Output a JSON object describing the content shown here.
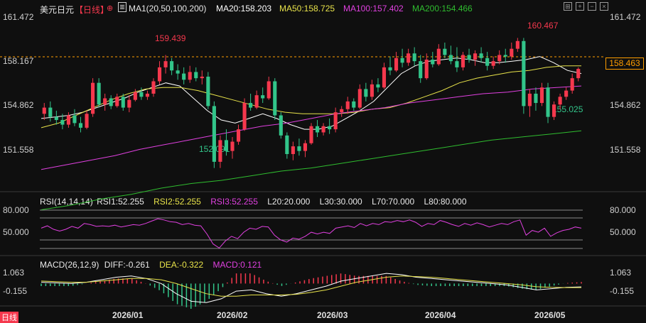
{
  "header": {
    "title": "美元日元",
    "period": "【日线】",
    "ma1": "MA1(20,50,100,200)",
    "ma20": "MA20:158.203",
    "ma50": "MA50:158.725",
    "ma100": "MA100:157.402",
    "ma200": "MA200:154.466"
  },
  "rsi_header": {
    "name": "RSI(14,14,14)",
    "rsi1": "RSI1:52.255",
    "rsi2": "RSI2:52.255",
    "rsi3": "RSI3:52.255",
    "l20": "L20:20.000",
    "l30": "L30:30.000",
    "l70": "L70:70.000",
    "l80": "L80:80.000"
  },
  "macd_header": {
    "name": "MACD(26,12,9)",
    "diff": "DIFF:-0.261",
    "dea": "DEA:-0.322",
    "macd": "MACD:0.121"
  },
  "price_axis": [
    "161.472",
    "158.167",
    "154.862",
    "151.558"
  ],
  "rsi_axis": [
    "80.000",
    "50.000"
  ],
  "macd_axis": [
    "1.063",
    "-0.155"
  ],
  "x_axis": [
    "2026/01",
    "2026/02",
    "2026/03",
    "2026/04",
    "2026/05"
  ],
  "annotations": {
    "high1": "159.439",
    "low1": "152.091",
    "high2": "160.467",
    "low2": "155.025",
    "last_price": "158.463"
  },
  "bottom_mark": "日线",
  "colors": {
    "up": "#f5384d",
    "down": "#32c58a",
    "ma20": "#ffffff",
    "ma50": "#e8e34a",
    "ma100": "#e040e0",
    "ma200": "#2fbd2f",
    "rsi": "#e040e0",
    "dea": "#e8e34a",
    "last_price": "#ff9d00"
  },
  "chart_data": [
    {
      "type": "candlestick",
      "title": "美元日元 日线",
      "ylim": [
        150.8,
        162.4
      ],
      "x_range": [
        "2025-12-01",
        "2026-05-10"
      ],
      "candles_ohlc_approx": [
        [
          155.6,
          156.3,
          155.2,
          156.0
        ],
        [
          156.0,
          156.4,
          155.1,
          155.4
        ],
        [
          155.4,
          155.8,
          154.9,
          155.2
        ],
        [
          155.2,
          155.6,
          154.6,
          154.9
        ],
        [
          154.9,
          155.7,
          154.7,
          155.5
        ],
        [
          155.5,
          155.9,
          154.8,
          155.0
        ],
        [
          155.0,
          155.4,
          154.4,
          154.7
        ],
        [
          154.7,
          155.8,
          154.6,
          155.6
        ],
        [
          155.6,
          157.9,
          155.4,
          157.6
        ],
        [
          157.6,
          157.9,
          156.0,
          156.2
        ],
        [
          156.2,
          156.9,
          155.8,
          156.6
        ],
        [
          156.6,
          156.8,
          155.9,
          156.1
        ],
        [
          156.1,
          156.9,
          156.0,
          156.7
        ],
        [
          156.7,
          156.9,
          155.8,
          156.0
        ],
        [
          156.0,
          156.8,
          155.7,
          156.5
        ],
        [
          156.5,
          157.2,
          156.4,
          157.0
        ],
        [
          157.0,
          157.3,
          156.5,
          156.7
        ],
        [
          156.7,
          157.1,
          156.5,
          156.9
        ],
        [
          156.9,
          157.9,
          156.7,
          157.7
        ],
        [
          157.7,
          159.0,
          157.5,
          158.6
        ],
        [
          158.6,
          159.4,
          158.2,
          159.0
        ],
        [
          159.0,
          159.2,
          158.1,
          158.4
        ],
        [
          158.4,
          158.8,
          157.8,
          158.2
        ],
        [
          158.2,
          158.6,
          157.5,
          157.8
        ],
        [
          157.8,
          158.7,
          157.6,
          158.3
        ],
        [
          158.3,
          158.6,
          157.7,
          157.9
        ],
        [
          157.9,
          158.4,
          157.5,
          158.0
        ],
        [
          158.0,
          158.3,
          155.9,
          156.1
        ],
        [
          156.1,
          156.4,
          152.1,
          152.5
        ],
        [
          152.5,
          154.2,
          152.1,
          153.9
        ],
        [
          153.9,
          154.6,
          152.9,
          153.2
        ],
        [
          153.2,
          154.1,
          152.7,
          153.8
        ],
        [
          153.8,
          154.9,
          153.6,
          154.6
        ],
        [
          154.6,
          156.6,
          154.5,
          156.3
        ],
        [
          156.3,
          156.9,
          155.8,
          156.0
        ],
        [
          156.0,
          157.1,
          155.9,
          156.8
        ],
        [
          156.8,
          157.3,
          156.3,
          156.6
        ],
        [
          156.6,
          158.0,
          156.5,
          157.7
        ],
        [
          157.7,
          157.9,
          155.2,
          155.5
        ],
        [
          155.5,
          155.7,
          154.0,
          154.2
        ],
        [
          154.2,
          154.4,
          152.7,
          153.0
        ],
        [
          153.0,
          153.8,
          152.6,
          153.5
        ],
        [
          153.5,
          154.0,
          152.9,
          153.2
        ],
        [
          153.2,
          153.9,
          152.8,
          153.7
        ],
        [
          153.7,
          155.0,
          153.6,
          154.8
        ],
        [
          154.8,
          155.2,
          154.1,
          154.4
        ],
        [
          154.4,
          155.0,
          154.2,
          154.8
        ],
        [
          154.8,
          155.3,
          154.3,
          154.6
        ],
        [
          154.6,
          156.0,
          154.4,
          155.7
        ],
        [
          155.7,
          156.1,
          155.4,
          155.9
        ],
        [
          155.9,
          156.7,
          155.6,
          156.4
        ],
        [
          156.4,
          156.6,
          155.8,
          156.0
        ],
        [
          156.0,
          157.5,
          155.9,
          157.2
        ],
        [
          157.2,
          157.6,
          156.4,
          156.7
        ],
        [
          156.7,
          157.8,
          156.5,
          157.5
        ],
        [
          157.5,
          157.9,
          157.0,
          157.3
        ],
        [
          157.3,
          158.9,
          157.2,
          158.6
        ],
        [
          158.6,
          159.3,
          158.1,
          158.4
        ],
        [
          158.4,
          159.6,
          158.3,
          159.2
        ],
        [
          159.2,
          159.8,
          158.6,
          158.9
        ],
        [
          158.9,
          159.8,
          158.7,
          159.5
        ],
        [
          159.5,
          159.9,
          158.7,
          159.0
        ],
        [
          159.0,
          159.4,
          157.6,
          157.9
        ],
        [
          157.9,
          159.5,
          157.8,
          159.1
        ],
        [
          159.1,
          159.6,
          158.6,
          158.8
        ],
        [
          158.8,
          160.1,
          158.7,
          159.8
        ],
        [
          159.8,
          160.2,
          159.2,
          159.4
        ],
        [
          159.4,
          160.0,
          158.8,
          159.0
        ],
        [
          159.0,
          159.9,
          158.3,
          158.6
        ],
        [
          158.6,
          159.6,
          158.4,
          159.4
        ],
        [
          159.4,
          159.8,
          158.9,
          159.1
        ],
        [
          159.1,
          159.7,
          158.7,
          159.5
        ],
        [
          159.5,
          159.9,
          158.9,
          159.2
        ],
        [
          159.2,
          159.6,
          158.4,
          158.7
        ],
        [
          158.7,
          159.3,
          158.5,
          159.0
        ],
        [
          159.0,
          159.7,
          158.8,
          159.4
        ],
        [
          159.4,
          159.8,
          158.9,
          159.3
        ],
        [
          159.3,
          160.2,
          159.1,
          159.8
        ],
        [
          159.8,
          160.5,
          159.6,
          160.3
        ],
        [
          160.3,
          160.5,
          155.6,
          156.1
        ],
        [
          156.1,
          157.2,
          155.4,
          156.9
        ],
        [
          156.9,
          157.3,
          155.8,
          156.3
        ],
        [
          156.3,
          157.6,
          156.1,
          157.3
        ],
        [
          157.3,
          157.6,
          155.0,
          155.4
        ],
        [
          155.4,
          156.4,
          155.2,
          156.2
        ],
        [
          156.2,
          156.9,
          155.9,
          156.7
        ],
        [
          156.7,
          157.3,
          156.5,
          157.1
        ],
        [
          157.1,
          158.2,
          156.9,
          157.9
        ],
        [
          157.9,
          158.6,
          157.7,
          158.5
        ]
      ],
      "series": [
        {
          "name": "MA20",
          "values": [
            155.3,
            155.4,
            155.5,
            155.7,
            156.0,
            156.3,
            156.6,
            157.0,
            157.3,
            157.6,
            157.4,
            156.6,
            155.8,
            155.2,
            155.0,
            155.3,
            155.6,
            155.3,
            154.9,
            154.6,
            154.6,
            154.8,
            155.3,
            155.8,
            156.4,
            157.3,
            158.2,
            158.7,
            159.0,
            159.1,
            159.2,
            159.1,
            158.9,
            158.9,
            159.0,
            159.1,
            159.3,
            158.9,
            158.4,
            158.2
          ]
        },
        {
          "name": "MA50",
          "values": [
            154.7,
            155.0,
            155.5,
            156.0,
            156.5,
            156.9,
            157.2,
            157.3,
            157.3,
            157.1,
            156.8,
            156.5,
            156.2,
            155.9,
            155.7,
            155.6,
            155.6,
            155.6,
            155.7,
            155.9,
            156.0,
            156.3,
            156.7,
            157.1,
            157.6,
            157.9,
            158.1,
            158.3,
            158.4,
            158.6,
            158.7,
            158.7
          ]
        },
        {
          "name": "MA100",
          "values": [
            152.0,
            152.3,
            152.6,
            152.9,
            153.3,
            153.6,
            153.9,
            154.2,
            154.5,
            154.8,
            155.0,
            155.3,
            155.6,
            155.8,
            156.0,
            156.3,
            156.5,
            156.7,
            156.9,
            157.0,
            157.2,
            157.3,
            157.4
          ]
        },
        {
          "name": "MA200",
          "values": [
            149.4,
            149.7,
            150.1,
            150.4,
            150.8,
            151.1,
            151.3,
            151.6,
            151.9,
            152.1,
            152.4,
            152.7,
            153.0,
            153.3,
            153.6,
            153.9,
            154.1,
            154.3,
            154.5
          ]
        }
      ]
    },
    {
      "type": "line",
      "title": "RSI(14,14,14)",
      "ylim": [
        10,
        90
      ],
      "values_approx": [
        52,
        56,
        50,
        47,
        50,
        55,
        52,
        60,
        58,
        55,
        56,
        55,
        57,
        54,
        56,
        58,
        57,
        60,
        64,
        68,
        66,
        63,
        62,
        58,
        60,
        57,
        56,
        42,
        25,
        18,
        30,
        38,
        34,
        45,
        52,
        50,
        55,
        54,
        40,
        32,
        28,
        35,
        33,
        38,
        45,
        42,
        45,
        43,
        52,
        54,
        56,
        53,
        60,
        56,
        60,
        58,
        63,
        62,
        65,
        63,
        66,
        62,
        55,
        60,
        58,
        65,
        62,
        58,
        55,
        60,
        57,
        61,
        58,
        54,
        57,
        60,
        58,
        63,
        66,
        40,
        48,
        45,
        52,
        38,
        44,
        48,
        50,
        54,
        52
      ]
    },
    {
      "type": "line",
      "title": "MACD(26,12,9)",
      "series": [
        {
          "name": "DIFF",
          "values": [
            0.1,
            0.05,
            0.0,
            0.1,
            0.3,
            0.5,
            0.6,
            0.4,
            0.0,
            -0.8,
            -1.4,
            -1.5,
            -1.2,
            -0.6,
            -0.5,
            -0.8,
            -1.0,
            -0.8,
            -0.5,
            -0.2,
            0.2,
            0.4,
            0.6,
            0.8,
            0.7,
            0.5,
            0.4,
            0.3,
            0.2,
            0.1,
            0.0,
            -0.1,
            -0.3,
            -0.5,
            -0.4,
            -0.3,
            -0.26
          ]
        },
        {
          "name": "DEA",
          "values": [
            0.2,
            0.15,
            0.1,
            0.1,
            0.2,
            0.3,
            0.4,
            0.4,
            0.3,
            0.0,
            -0.4,
            -0.8,
            -1.0,
            -1.0,
            -0.9,
            -0.9,
            -0.9,
            -0.85,
            -0.7,
            -0.5,
            -0.2,
            0.1,
            0.3,
            0.5,
            0.6,
            0.55,
            0.5,
            0.4,
            0.3,
            0.2,
            0.1,
            0.0,
            -0.1,
            -0.25,
            -0.3,
            -0.32,
            -0.32
          ]
        }
      ],
      "ylim": [
        -1.6,
        1.2
      ]
    }
  ]
}
